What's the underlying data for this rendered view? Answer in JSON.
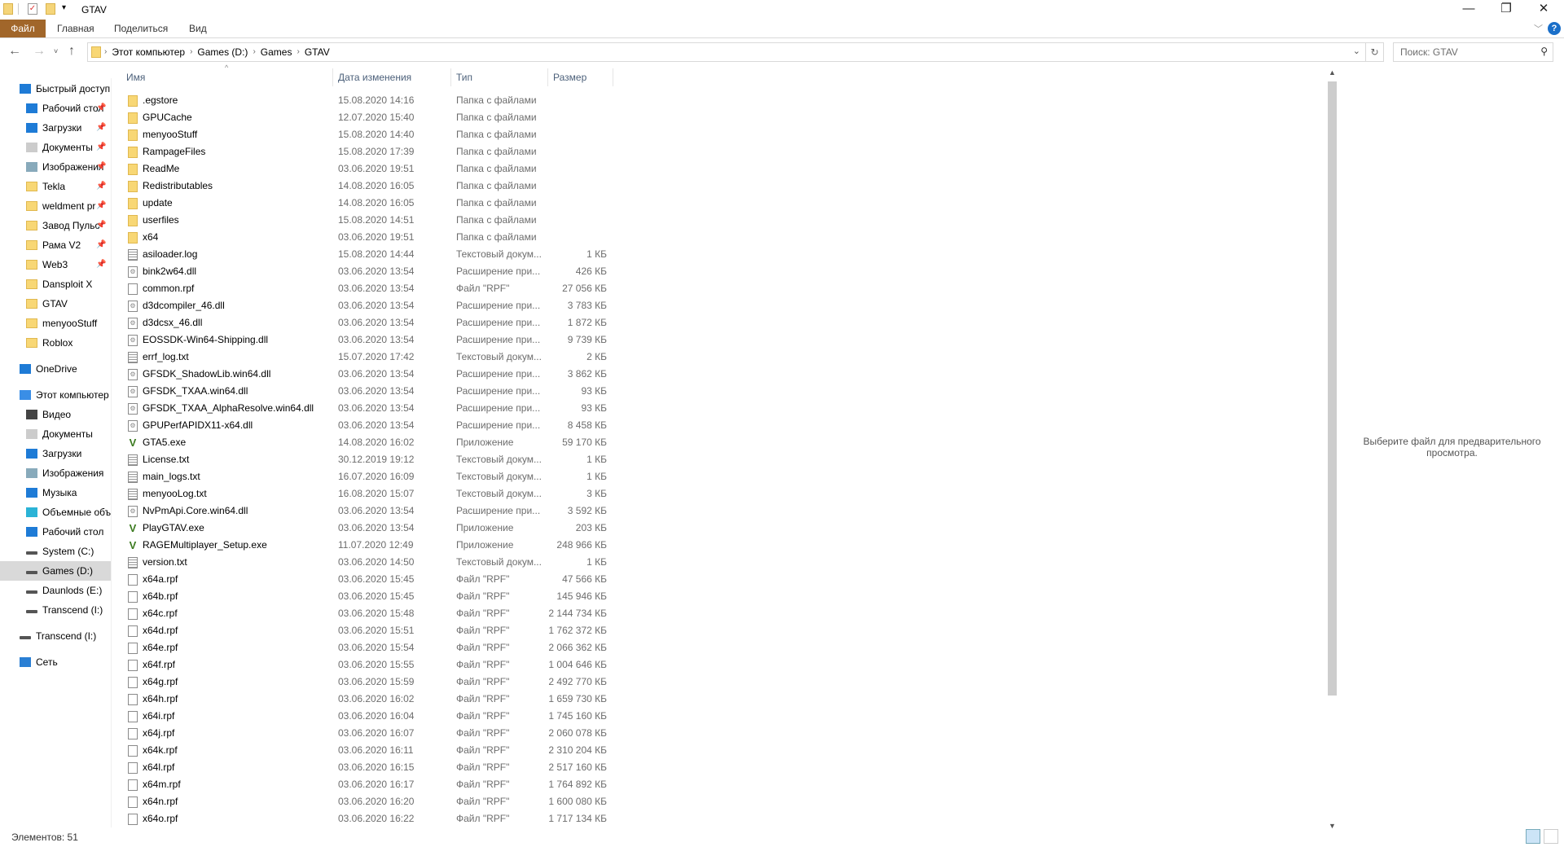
{
  "window": {
    "title": "GTAV"
  },
  "ribbon": {
    "tabs": [
      "Файл",
      "Главная",
      "Поделиться",
      "Вид"
    ],
    "help": "?"
  },
  "address": {
    "crumbs": [
      "Этот компьютер",
      "Games (D:)",
      "Games",
      "GTAV"
    ]
  },
  "search": {
    "placeholder": "Поиск: GTAV"
  },
  "sidebar": {
    "items": [
      {
        "label": "Быстрый доступ",
        "icon": "star-icon"
      },
      {
        "label": "Рабочий стол",
        "icon": "desktop-icon",
        "pinned": true
      },
      {
        "label": "Загрузки",
        "icon": "download-icon",
        "pinned": true
      },
      {
        "label": "Документы",
        "icon": "documents-icon",
        "pinned": true
      },
      {
        "label": "Изображения",
        "icon": "pictures-icon",
        "pinned": true
      },
      {
        "label": "Tekla",
        "icon": "folder-icon",
        "pinned": true
      },
      {
        "label": "weldment pr",
        "icon": "folder-icon",
        "pinned": true
      },
      {
        "label": "Завод Пульс",
        "icon": "folder-icon",
        "pinned": true
      },
      {
        "label": "Рама V2",
        "icon": "folder-icon",
        "pinned": true
      },
      {
        "label": "Web3",
        "icon": "folder-icon",
        "pinned": true
      },
      {
        "label": "Dansploit X",
        "icon": "folder-icon"
      },
      {
        "label": "GTAV",
        "icon": "folder-icon"
      },
      {
        "label": "menyooStuff",
        "icon": "folder-icon"
      },
      {
        "label": "Roblox",
        "icon": "folder-icon"
      },
      {
        "label": "OneDrive",
        "icon": "cloud-icon"
      },
      {
        "label": "Этот компьютер",
        "icon": "computer-icon"
      },
      {
        "label": "Видео",
        "icon": "video-icon"
      },
      {
        "label": "Документы",
        "icon": "documents-icon"
      },
      {
        "label": "Загрузки",
        "icon": "download-icon"
      },
      {
        "label": "Изображения",
        "icon": "pictures-icon"
      },
      {
        "label": "Музыка",
        "icon": "music-icon"
      },
      {
        "label": "Объемные объекты",
        "icon": "3d-objects-icon"
      },
      {
        "label": "Рабочий стол",
        "icon": "desktop-icon"
      },
      {
        "label": "System (C:)",
        "icon": "drive-icon"
      },
      {
        "label": "Games (D:)",
        "icon": "drive-icon",
        "selected": true
      },
      {
        "label": "Daunlods (E:)",
        "icon": "drive-icon"
      },
      {
        "label": "Transcend (I:)",
        "icon": "drive-icon"
      },
      {
        "label": "Transcend (I:)",
        "icon": "drive-icon"
      },
      {
        "label": "Сеть",
        "icon": "network-icon"
      }
    ]
  },
  "columns": [
    "Имя",
    "Дата изменения",
    "Тип",
    "Размер"
  ],
  "files": [
    {
      "name": ".egstore",
      "date": "15.08.2020 14:16",
      "type": "Папка с файлами",
      "size": "",
      "kind": "folder"
    },
    {
      "name": "GPUCache",
      "date": "12.07.2020 15:40",
      "type": "Папка с файлами",
      "size": "",
      "kind": "folder"
    },
    {
      "name": "menyooStuff",
      "date": "15.08.2020 14:40",
      "type": "Папка с файлами",
      "size": "",
      "kind": "folder"
    },
    {
      "name": "RampageFiles",
      "date": "15.08.2020 17:39",
      "type": "Папка с файлами",
      "size": "",
      "kind": "folder"
    },
    {
      "name": "ReadMe",
      "date": "03.06.2020 19:51",
      "type": "Папка с файлами",
      "size": "",
      "kind": "folder"
    },
    {
      "name": "Redistributables",
      "date": "14.08.2020 16:05",
      "type": "Папка с файлами",
      "size": "",
      "kind": "folder"
    },
    {
      "name": "update",
      "date": "14.08.2020 16:05",
      "type": "Папка с файлами",
      "size": "",
      "kind": "folder"
    },
    {
      "name": "userfiles",
      "date": "15.08.2020 14:51",
      "type": "Папка с файлами",
      "size": "",
      "kind": "folder"
    },
    {
      "name": "x64",
      "date": "03.06.2020 19:51",
      "type": "Папка с файлами",
      "size": "",
      "kind": "folder"
    },
    {
      "name": "asiloader.log",
      "date": "15.08.2020 14:44",
      "type": "Текстовый докум...",
      "size": "1 КБ",
      "kind": "txt"
    },
    {
      "name": "bink2w64.dll",
      "date": "03.06.2020 13:54",
      "type": "Расширение при...",
      "size": "426 КБ",
      "kind": "dll"
    },
    {
      "name": "common.rpf",
      "date": "03.06.2020 13:54",
      "type": "Файл \"RPF\"",
      "size": "27 056 КБ",
      "kind": "doc"
    },
    {
      "name": "d3dcompiler_46.dll",
      "date": "03.06.2020 13:54",
      "type": "Расширение при...",
      "size": "3 783 КБ",
      "kind": "dll"
    },
    {
      "name": "d3dcsx_46.dll",
      "date": "03.06.2020 13:54",
      "type": "Расширение при...",
      "size": "1 872 КБ",
      "kind": "dll"
    },
    {
      "name": "EOSSDK-Win64-Shipping.dll",
      "date": "03.06.2020 13:54",
      "type": "Расширение при...",
      "size": "9 739 КБ",
      "kind": "dll"
    },
    {
      "name": "errf_log.txt",
      "date": "15.07.2020 17:42",
      "type": "Текстовый докум...",
      "size": "2 КБ",
      "kind": "txt"
    },
    {
      "name": "GFSDK_ShadowLib.win64.dll",
      "date": "03.06.2020 13:54",
      "type": "Расширение при...",
      "size": "3 862 КБ",
      "kind": "dll"
    },
    {
      "name": "GFSDK_TXAA.win64.dll",
      "date": "03.06.2020 13:54",
      "type": "Расширение при...",
      "size": "93 КБ",
      "kind": "dll"
    },
    {
      "name": "GFSDK_TXAA_AlphaResolve.win64.dll",
      "date": "03.06.2020 13:54",
      "type": "Расширение при...",
      "size": "93 КБ",
      "kind": "dll"
    },
    {
      "name": "GPUPerfAPIDX11-x64.dll",
      "date": "03.06.2020 13:54",
      "type": "Расширение при...",
      "size": "8 458 КБ",
      "kind": "dll"
    },
    {
      "name": "GTA5.exe",
      "date": "14.08.2020 16:02",
      "type": "Приложение",
      "size": "59 170 КБ",
      "kind": "exe"
    },
    {
      "name": "License.txt",
      "date": "30.12.2019 19:12",
      "type": "Текстовый докум...",
      "size": "1 КБ",
      "kind": "txt"
    },
    {
      "name": "main_logs.txt",
      "date": "16.07.2020 16:09",
      "type": "Текстовый докум...",
      "size": "1 КБ",
      "kind": "txt"
    },
    {
      "name": "menyooLog.txt",
      "date": "16.08.2020 15:07",
      "type": "Текстовый докум...",
      "size": "3 КБ",
      "kind": "txt"
    },
    {
      "name": "NvPmApi.Core.win64.dll",
      "date": "03.06.2020 13:54",
      "type": "Расширение при...",
      "size": "3 592 КБ",
      "kind": "dll"
    },
    {
      "name": "PlayGTAV.exe",
      "date": "03.06.2020 13:54",
      "type": "Приложение",
      "size": "203 КБ",
      "kind": "exe"
    },
    {
      "name": "RAGEMultiplayer_Setup.exe",
      "date": "11.07.2020 12:49",
      "type": "Приложение",
      "size": "248 966 КБ",
      "kind": "exe"
    },
    {
      "name": "version.txt",
      "date": "03.06.2020 14:50",
      "type": "Текстовый докум...",
      "size": "1 КБ",
      "kind": "txt"
    },
    {
      "name": "x64a.rpf",
      "date": "03.06.2020 15:45",
      "type": "Файл \"RPF\"",
      "size": "47 566 КБ",
      "kind": "doc"
    },
    {
      "name": "x64b.rpf",
      "date": "03.06.2020 15:45",
      "type": "Файл \"RPF\"",
      "size": "145 946 КБ",
      "kind": "doc"
    },
    {
      "name": "x64c.rpf",
      "date": "03.06.2020 15:48",
      "type": "Файл \"RPF\"",
      "size": "2 144 734 КБ",
      "kind": "doc"
    },
    {
      "name": "x64d.rpf",
      "date": "03.06.2020 15:51",
      "type": "Файл \"RPF\"",
      "size": "1 762 372 КБ",
      "kind": "doc"
    },
    {
      "name": "x64e.rpf",
      "date": "03.06.2020 15:54",
      "type": "Файл \"RPF\"",
      "size": "2 066 362 КБ",
      "kind": "doc"
    },
    {
      "name": "x64f.rpf",
      "date": "03.06.2020 15:55",
      "type": "Файл \"RPF\"",
      "size": "1 004 646 КБ",
      "kind": "doc"
    },
    {
      "name": "x64g.rpf",
      "date": "03.06.2020 15:59",
      "type": "Файл \"RPF\"",
      "size": "2 492 770 КБ",
      "kind": "doc"
    },
    {
      "name": "x64h.rpf",
      "date": "03.06.2020 16:02",
      "type": "Файл \"RPF\"",
      "size": "1 659 730 КБ",
      "kind": "doc"
    },
    {
      "name": "x64i.rpf",
      "date": "03.06.2020 16:04",
      "type": "Файл \"RPF\"",
      "size": "1 745 160 КБ",
      "kind": "doc"
    },
    {
      "name": "x64j.rpf",
      "date": "03.06.2020 16:07",
      "type": "Файл \"RPF\"",
      "size": "2 060 078 КБ",
      "kind": "doc"
    },
    {
      "name": "x64k.rpf",
      "date": "03.06.2020 16:11",
      "type": "Файл \"RPF\"",
      "size": "2 310 204 КБ",
      "kind": "doc"
    },
    {
      "name": "x64l.rpf",
      "date": "03.06.2020 16:15",
      "type": "Файл \"RPF\"",
      "size": "2 517 160 КБ",
      "kind": "doc"
    },
    {
      "name": "x64m.rpf",
      "date": "03.06.2020 16:17",
      "type": "Файл \"RPF\"",
      "size": "1 764 892 КБ",
      "kind": "doc"
    },
    {
      "name": "x64n.rpf",
      "date": "03.06.2020 16:20",
      "type": "Файл \"RPF\"",
      "size": "1 600 080 КБ",
      "kind": "doc"
    },
    {
      "name": "x64o.rpf",
      "date": "03.06.2020 16:22",
      "type": "Файл \"RPF\"",
      "size": "1 717 134 КБ",
      "kind": "doc"
    }
  ],
  "preview": {
    "message": "Выберите файл для предварительного просмотра."
  },
  "status": {
    "items_count": "Элементов: 51"
  },
  "colors": {
    "file_tab": "#a1662a",
    "selected": "#d9d9d9",
    "header_text": "#4c607a"
  }
}
